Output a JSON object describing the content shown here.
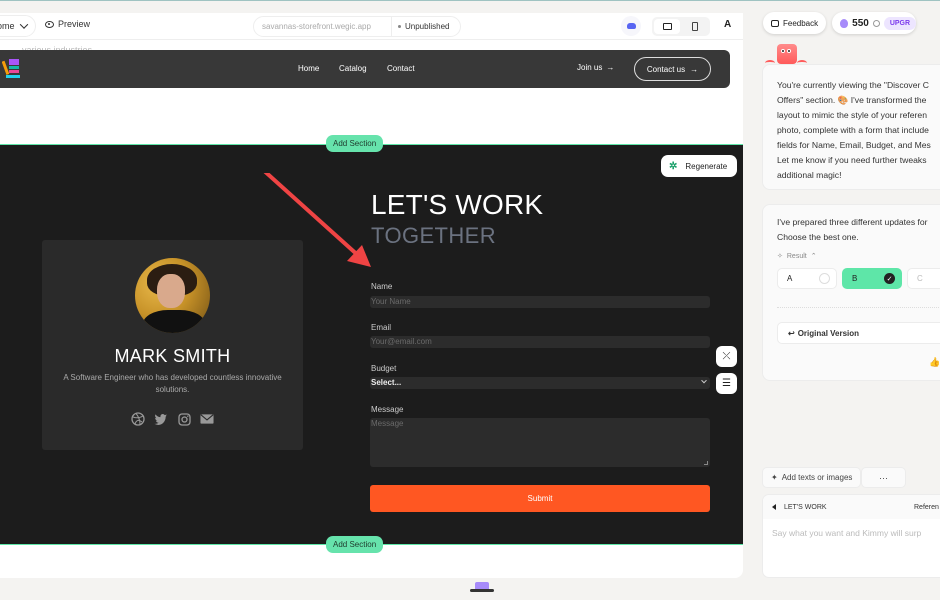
{
  "toolbar": {
    "page_select": "ome",
    "preview": "Preview",
    "url": "savannas-storefront.wegic.app",
    "status": "Unpublished",
    "font_icon": "A"
  },
  "site_nav": {
    "ghost_text": "various industries",
    "links": [
      "Home",
      "Catalog",
      "Contact"
    ],
    "join": "Join us",
    "contact": "Contact us",
    "arrow": "→"
  },
  "section": {
    "add_section_top": "Add Section",
    "add_section_bottom": "Add Section",
    "regenerate": "Regenerate",
    "profile": {
      "name": "MARK SMITH",
      "description": "A Software Engineer who has developed countless innovative solutions.",
      "socials": [
        "dribbble-icon",
        "twitter-icon",
        "instagram-icon",
        "mail-icon"
      ]
    },
    "heading_line1": "LET'S WORK",
    "heading_line2": "TOGETHER",
    "form": {
      "name_label": "Name",
      "name_placeholder": "Your Name",
      "email_label": "Email",
      "email_placeholder": "Your@email.com",
      "budget_label": "Budget",
      "budget_value": "Select...",
      "message_label": "Message",
      "message_placeholder": "Message",
      "submit": "Submit"
    }
  },
  "panel": {
    "feedback": "Feedback",
    "credits": "550",
    "upgrade": "UPGR",
    "message1": [
      "You're currently viewing the \"Discover C",
      "Offers\" section. 🎨 I've transformed the",
      "layout to mimic the style of your referen",
      "photo, complete with a form that include",
      "fields for Name, Email, Budget, and Mes",
      "Let me know if you need further tweaks",
      "additional magic!"
    ],
    "message2": [
      "I've prepared three different updates for",
      "Choose the best one."
    ],
    "result_label": "Result",
    "options": [
      {
        "label": "A",
        "selected": false
      },
      {
        "label": "B",
        "selected": true
      },
      {
        "label": "C",
        "selected": false
      }
    ],
    "original_version": "Original Version",
    "add_texts": "Add texts or images",
    "more": "···",
    "context_tag": "LET'S WORK",
    "reference": "Referen",
    "input_placeholder": "Say what you want and Kimmy will surp"
  },
  "colors": {
    "accent_green": "#5ee6a8",
    "submit_orange": "#ff5722",
    "section_bg": "#1c1c1c"
  }
}
